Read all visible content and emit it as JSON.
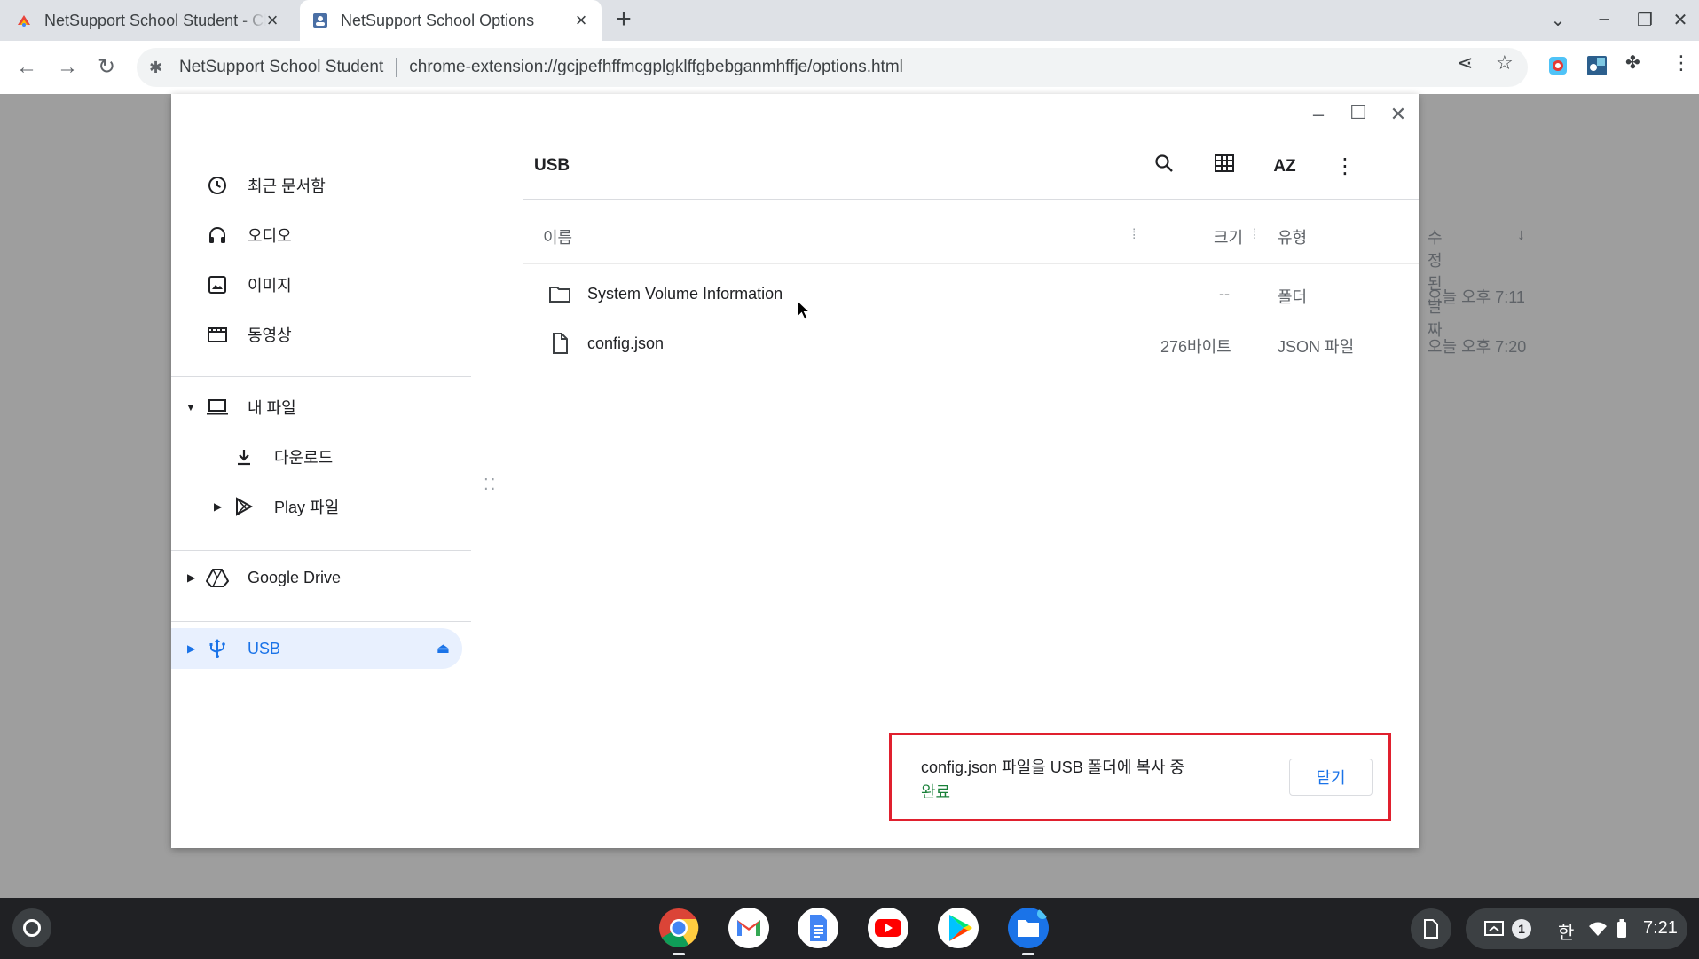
{
  "browser": {
    "tabs": [
      {
        "title": "NetSupport School Student - Chrome"
      },
      {
        "title": "NetSupport School Options"
      }
    ],
    "omnibox": {
      "origin": "NetSupport School Student",
      "url": "chrome-extension://gcjpefhffmcgplgklffgbebganmhffje/options.html"
    }
  },
  "files": {
    "sidebar": {
      "recent": "최근 문서함",
      "audio": "오디오",
      "images": "이미지",
      "videos": "동영상",
      "my_files": "내 파일",
      "downloads": "다운로드",
      "play_files": "Play 파일",
      "google_drive": "Google Drive",
      "usb": "USB"
    },
    "title": "USB",
    "columns": {
      "name": "이름",
      "size": "크기",
      "type": "유형",
      "modified": "수정된 날짜"
    },
    "rows": [
      {
        "name": "System Volume Information",
        "size": "--",
        "type": "폴더",
        "modified": "오늘 오후 7:11"
      },
      {
        "name": "config.json",
        "size": "276바이트",
        "type": "JSON 파일",
        "modified": "오늘 오후 7:20"
      }
    ],
    "toast": {
      "message": "config.json 파일을 USB 폴더에 복사 중",
      "status": "완료",
      "close_label": "닫기"
    }
  },
  "shelf": {
    "tray": {
      "notification_count": "1",
      "ime": "한",
      "time": "7:21"
    }
  },
  "colors": {
    "accent": "#1a73e8",
    "success": "#188038",
    "highlight_border": "#e0202e"
  }
}
